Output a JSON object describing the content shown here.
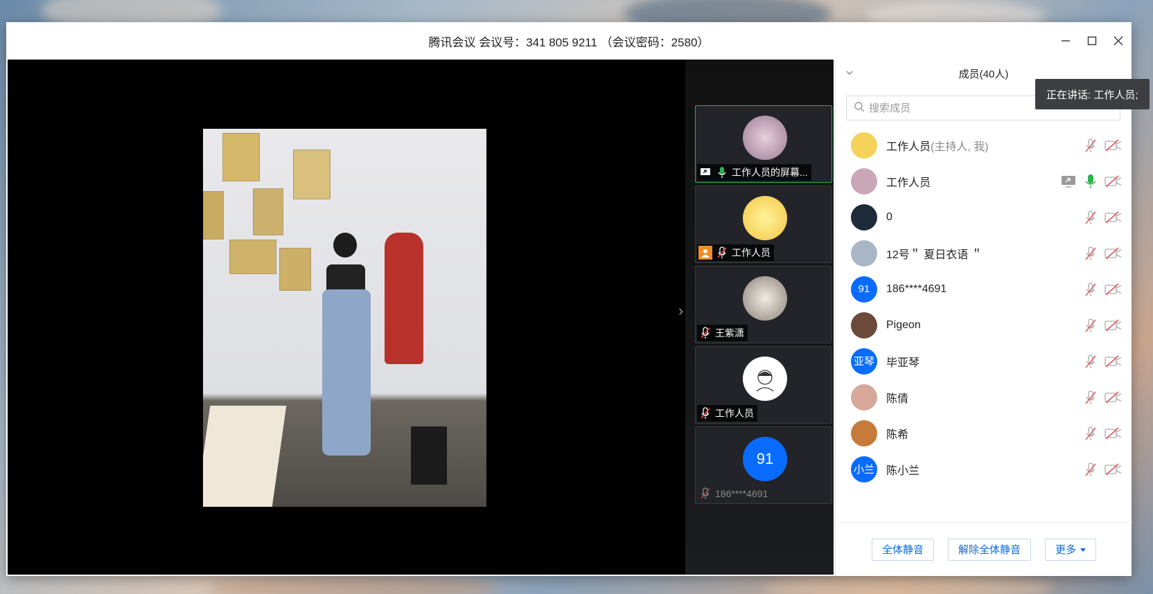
{
  "window": {
    "title": "腾讯会议 会议号：341 805 9211 （会议密码：2580）"
  },
  "tooltip": {
    "text": "正在讲话: 工作人员;"
  },
  "thumbnails": [
    {
      "label": "工作人员的屏幕...",
      "active": true,
      "icons": [
        "screen-share-icon",
        "mic-on-icon"
      ]
    },
    {
      "label": "工作人员",
      "active": false,
      "icons": [
        "host-icon",
        "mic-muted-icon"
      ]
    },
    {
      "label": "王紫潇",
      "active": false,
      "icons": [
        "mic-muted-icon"
      ]
    },
    {
      "label": "工作人员",
      "active": false,
      "icons": [
        "mic-muted-icon"
      ]
    },
    {
      "label": "186****4691",
      "avatar_text": "91",
      "active": false,
      "icons": [
        "mic-muted-icon"
      ]
    }
  ],
  "panel": {
    "title": "成员(40人)",
    "search_placeholder": "搜索成员",
    "members": [
      {
        "name": "工作人员",
        "role": "(主持人, 我)",
        "avatar_text": "",
        "avatar_color": "#f5d25a",
        "mic": "muted",
        "video": "off"
      },
      {
        "name": "工作人员",
        "role": "",
        "avatar_text": "",
        "avatar_color": "#c9a7b9",
        "mic": "on",
        "video": "off",
        "sharing": true
      },
      {
        "name": "0",
        "role": "",
        "avatar_text": "",
        "avatar_color": "#1d2a3a",
        "mic": "muted",
        "video": "off"
      },
      {
        "name": "12号＂ 夏日衣语 ＂",
        "role": "",
        "avatar_text": "",
        "avatar_color": "#a9b6c6",
        "mic": "muted",
        "video": "off"
      },
      {
        "name": "186****4691",
        "role": "",
        "avatar_text": "91",
        "avatar_color": "#0a6cff",
        "mic": "muted",
        "video": "off"
      },
      {
        "name": "Pigeon",
        "role": "",
        "avatar_text": "",
        "avatar_color": "#6b4a3a",
        "mic": "muted",
        "video": "off"
      },
      {
        "name": "毕亚琴",
        "role": "",
        "avatar_text": "亚琴",
        "avatar_color": "#0a6cff",
        "mic": "muted",
        "video": "off"
      },
      {
        "name": "陈倩",
        "role": "",
        "avatar_text": "",
        "avatar_color": "#d7a79a",
        "mic": "muted",
        "video": "off"
      },
      {
        "name": "陈希",
        "role": "",
        "avatar_text": "",
        "avatar_color": "#c77b3a",
        "mic": "muted",
        "video": "off"
      },
      {
        "name": "陈小兰",
        "role": "",
        "avatar_text": "小兰",
        "avatar_color": "#0a6cff",
        "mic": "muted",
        "video": "off"
      }
    ],
    "buttons": {
      "mute_all": "全体静音",
      "unmute_all": "解除全体静音",
      "more": "更多"
    }
  },
  "colors": {
    "accent": "#0a6bd6",
    "active_border": "#2bb24c",
    "mic_on": "#2bb24c",
    "stage_bg": "#000000"
  }
}
